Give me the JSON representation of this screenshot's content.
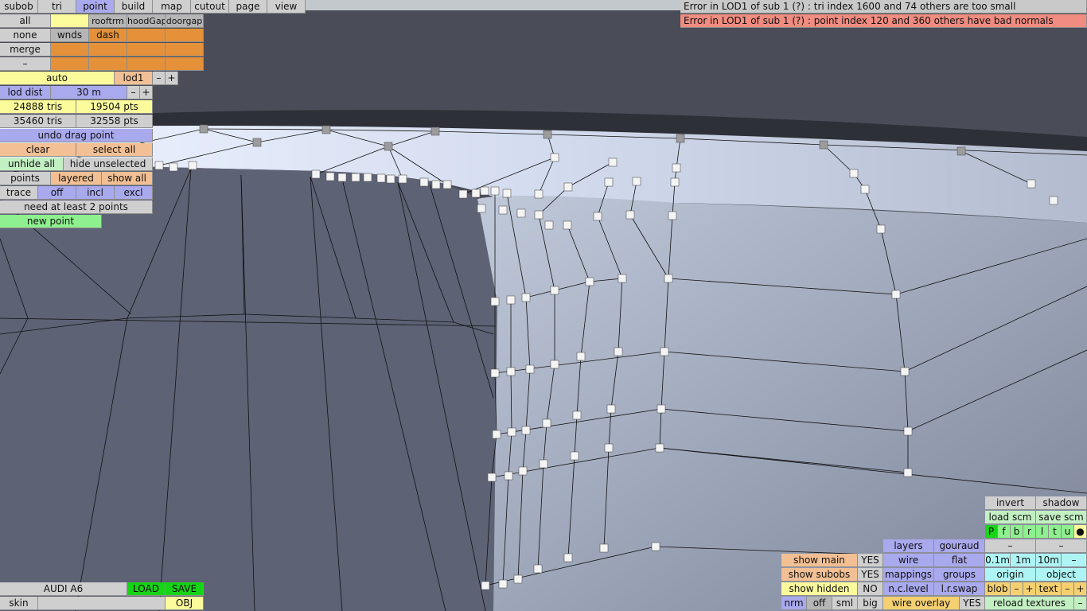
{
  "menu": {
    "tabs": [
      "subob",
      "tri",
      "point",
      "build",
      "map",
      "cutout",
      "page",
      "view"
    ],
    "active": "point"
  },
  "errors": [
    "Error in LOD1 of sub 1 (?) : tri index 1600 and 74 others are too small",
    "Error in LOD1 of sub 1 (?) : point index 120 and 360 others have bad normals"
  ],
  "select_grid": {
    "all": "all",
    "none": "none",
    "merge": "merge",
    "dash_row": "–",
    "rooftrm": "rooftrm",
    "hoodGap": "hoodGap",
    "doorgap": "doorgap",
    "wnds": "wnds",
    "dash": "dash"
  },
  "lod": {
    "auto": "auto",
    "lod1": "lod1",
    "minus": "–",
    "plus": "+",
    "dist_label": "lod dist",
    "dist_value": "30 m"
  },
  "stats": {
    "tris1": "24888 tris",
    "pts1": "19504 pts",
    "tris2": "35460 tris",
    "pts2": "32558 pts"
  },
  "actions": {
    "undo": "undo drag point",
    "clear": "clear",
    "select_all": "select all",
    "unhide_all": "unhide all",
    "hide_unselected": "hide unselected",
    "points": "points",
    "layered": "layered",
    "show_all": "show all",
    "trace": "trace",
    "off": "off",
    "incl": "incl",
    "excl": "excl",
    "need": "need at least 2 points",
    "new_point": "new point"
  },
  "bottom_left": {
    "model": "AUDI A6",
    "load": "LOAD",
    "save": "SAVE",
    "skin": "skin",
    "obj": "OBJ"
  },
  "bottom_right": {
    "invert": "invert",
    "shadow": "shadow",
    "load_scm": "load scm",
    "save_scm": "save scm",
    "flags": [
      "P",
      "f",
      "b",
      "r",
      "l",
      "t",
      "u",
      "●"
    ],
    "layers": "layers",
    "gouraud": "gouraud",
    "dash": "–",
    "show_main": "show main",
    "yes": "YES",
    "wire": "wire",
    "flat": "flat",
    "d01": "0.1m",
    "d1": "1m",
    "d10": "10m",
    "show_subobs": "show subobs",
    "mappings": "mappings",
    "groups": "groups",
    "origin": "origin",
    "object": "object",
    "show_hidden": "show hidden",
    "no": "NO",
    "nclevel": "n.c.level",
    "lrswap": "l.r.swap",
    "blob": "blob",
    "minus": "–",
    "plus": "+",
    "text": "text",
    "nrm": "nrm",
    "off": "off",
    "sml": "sml",
    "big": "big",
    "wire_overlay": "wire overlay",
    "reload_textures": "reload textures"
  },
  "colors": {
    "sky": "#c2c8cc",
    "bg": "#4a4d58",
    "upper": "#464955",
    "body": "#5d6275",
    "roof": "#c7d3e5"
  }
}
